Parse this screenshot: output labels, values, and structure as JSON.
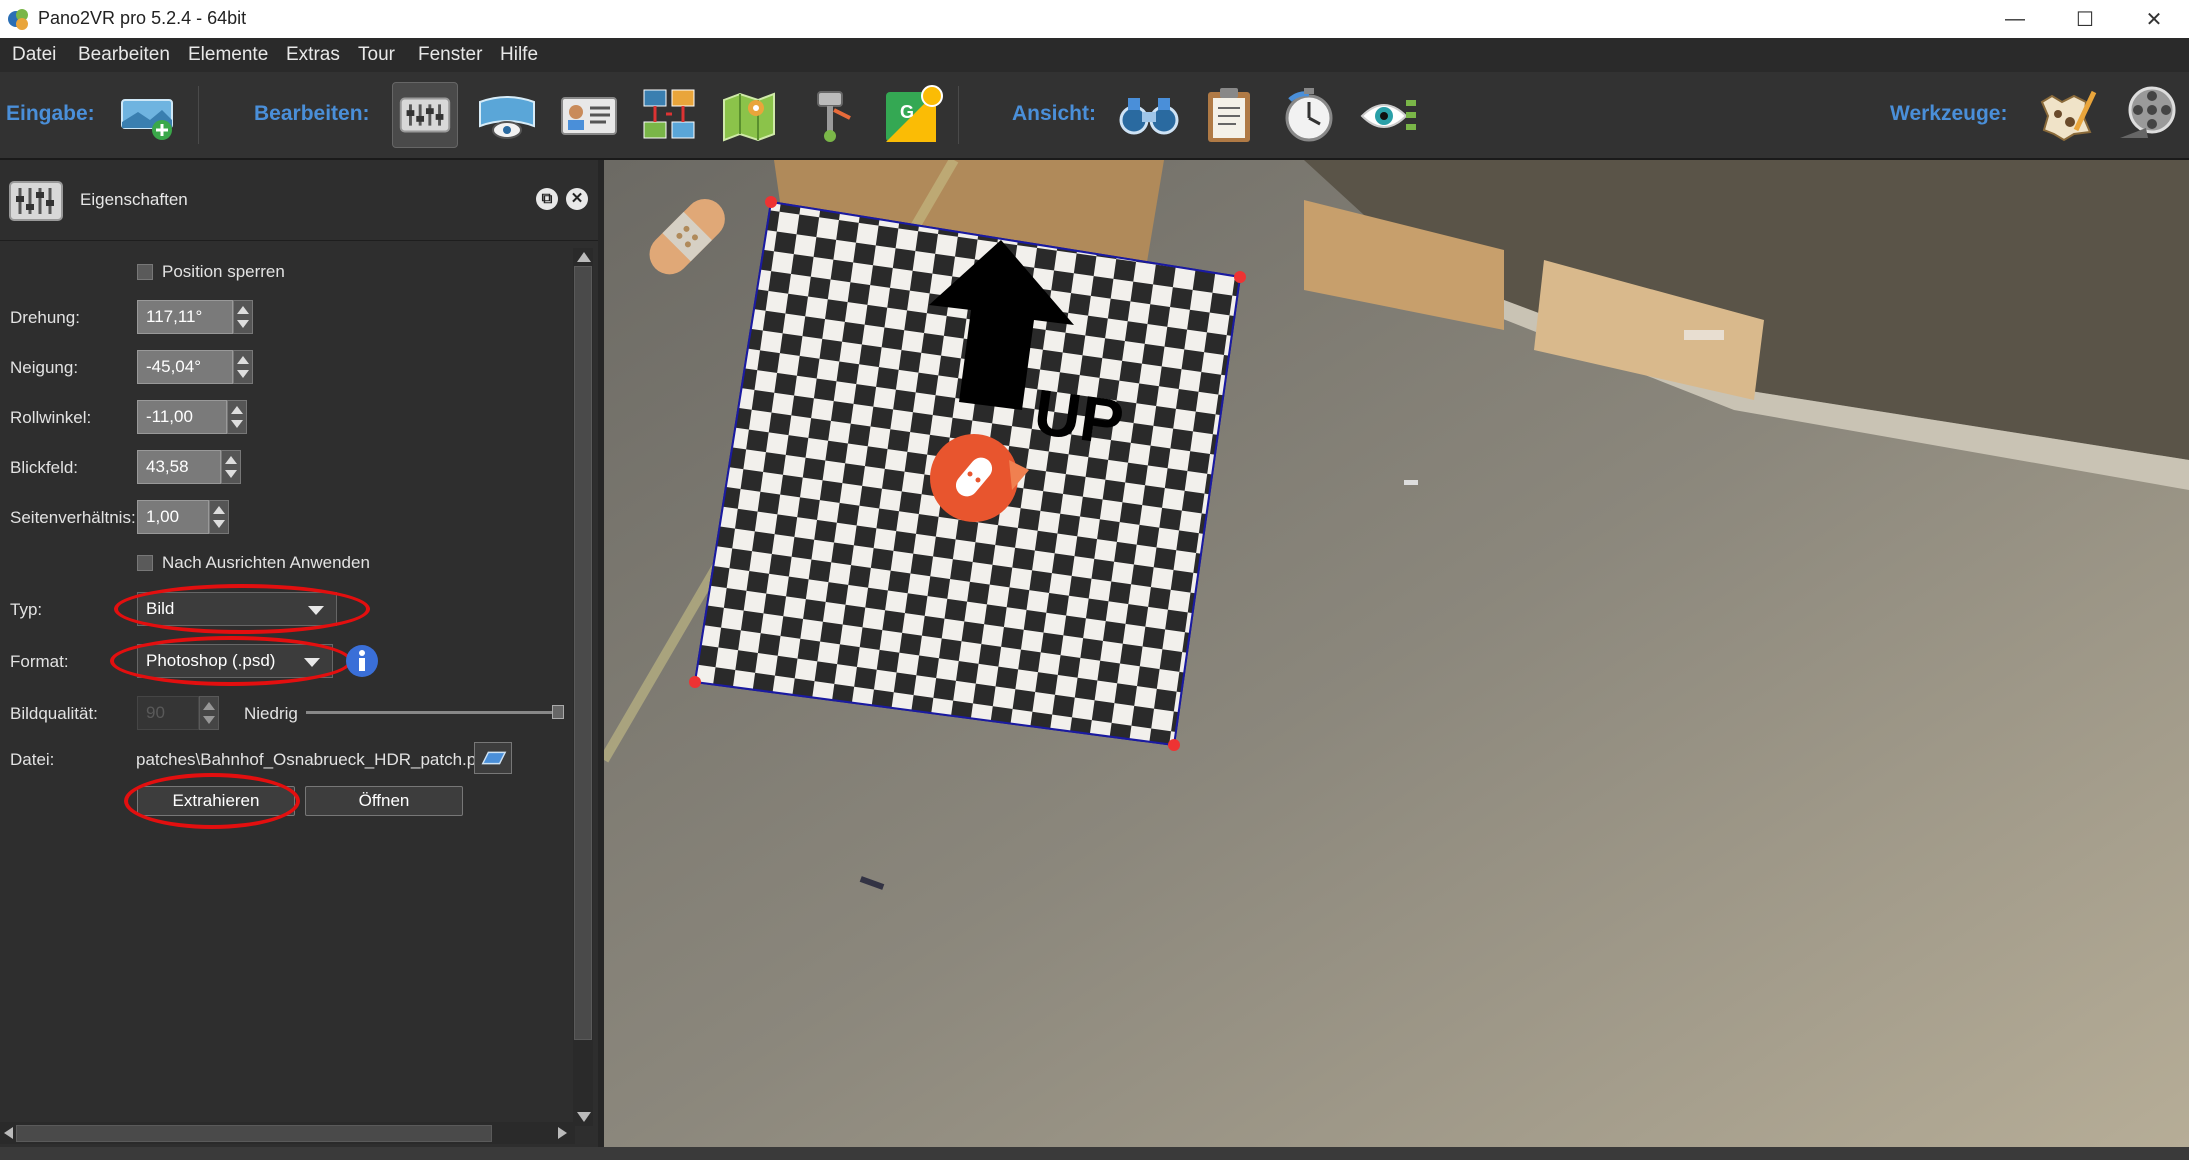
{
  "window": {
    "title": "Pano2VR pro 5.2.4 - 64bit",
    "controls": [
      "minimize-icon",
      "maximize-icon",
      "close-icon"
    ]
  },
  "menu": [
    "Datei",
    "Bearbeiten",
    "Elemente",
    "Extras",
    "Tour",
    "Fenster",
    "Hilfe"
  ],
  "toolbar": {
    "input_label": "Eingabe:",
    "edit_label": "Bearbeiten:",
    "view_label": "Ansicht:",
    "tools_label": "Werkzeuge:",
    "icons": {
      "input": [
        "add-panorama-icon"
      ],
      "edit": [
        "properties-icon",
        "viewing-parameters-icon",
        "user-data-icon",
        "tour-browser-icon",
        "map-icon",
        "patches-icon",
        "google-street-view-icon"
      ],
      "view": [
        "binoculars-icon",
        "clipboard-icon",
        "animation-timer-icon",
        "eye-settings-icon"
      ],
      "tools": [
        "skin-editor-icon",
        "video-tools-icon"
      ]
    }
  },
  "panel": {
    "title": "Eigenschaften",
    "position_lock_label": "Position sperren",
    "position_lock_checked": false,
    "fields": {
      "rotation": {
        "label": "Drehung:",
        "value": "117,11°"
      },
      "tilt": {
        "label": "Neigung:",
        "value": "-45,04°"
      },
      "roll": {
        "label": "Rollwinkel:",
        "value": "-11,00"
      },
      "fov": {
        "label": "Blickfeld:",
        "value": "43,58"
      },
      "aspect": {
        "label": "Seitenverhältnis:",
        "value": "1,00"
      }
    },
    "apply_after_align_label": "Nach Ausrichten Anwenden",
    "apply_after_align_checked": false,
    "type": {
      "label": "Typ:",
      "value": "Bild"
    },
    "format": {
      "label": "Format:",
      "value": "Photoshop (.psd)"
    },
    "quality": {
      "label": "Bildqualität:",
      "value": "90",
      "slider_label": "Niedrig",
      "level": 1.0
    },
    "file": {
      "label": "Datei:",
      "value": "patches\\Bahnhof_Osnabrueck_HDR_patch.psd"
    },
    "extract_button": "Extrahieren",
    "open_button": "Öffnen"
  },
  "viewer": {
    "patch_text": "UP"
  },
  "colors": {
    "accent_label": "#4a8fd9",
    "highlight_red": "#e30f0f",
    "panel_bg": "#2e2e2e",
    "toolbar_bg": "#323232"
  }
}
